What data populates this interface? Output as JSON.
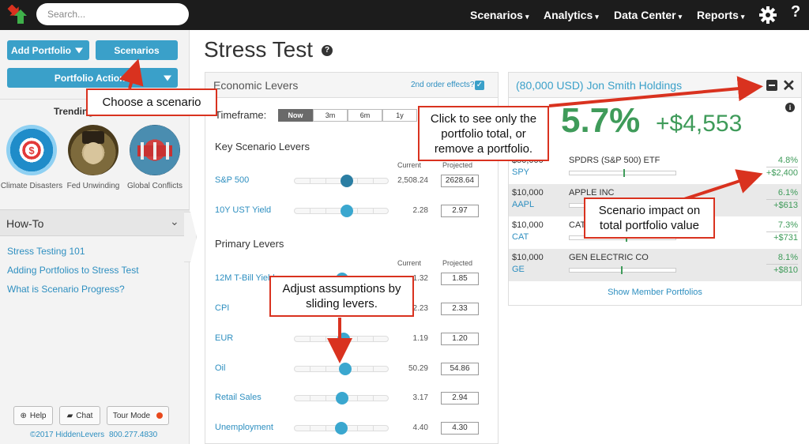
{
  "topbar": {
    "search_placeholder": "Search...",
    "nav": [
      "Scenarios",
      "Analytics",
      "Data Center",
      "Reports"
    ],
    "caret": "▾",
    "help": "?"
  },
  "sidebar": {
    "add_portfolio": "Add Portfolio",
    "scenarios": "Scenarios",
    "portfolio_actions": "Portfolio Actions",
    "trending_label": "Trending",
    "trending": [
      {
        "label": "Climate Disasters"
      },
      {
        "label": "Fed Unwinding"
      },
      {
        "label": "Global Conflicts"
      }
    ],
    "howto_title": "How-To",
    "howto_chevron": "⌄",
    "howto_links": [
      "Stress Testing 101",
      "Adding Portfolios to Stress Test",
      "What is Scenario Progress?"
    ],
    "footer_buttons": {
      "help": "Help",
      "chat": "Chat",
      "tour": "Tour Mode"
    },
    "copyright": "©2017 HiddenLevers",
    "phone": "800.277.4830"
  },
  "main": {
    "title": "Stress Test",
    "title_icon": "?",
    "levers_panel": {
      "title": "Economic Levers",
      "second_order": "2nd order effects?",
      "checked": "✓",
      "timeframe_label": "Timeframe:",
      "timeframes": [
        "Now",
        "3m",
        "6m",
        "1y"
      ],
      "key_title": "Key Scenario Levers",
      "primary_title": "Primary Levers",
      "col_current": "Current",
      "col_projected": "Projected",
      "key_levers": [
        {
          "name": "S&P 500",
          "current": "2,508.24",
          "projected": "2628.64",
          "level": 0.55
        },
        {
          "name": "10Y UST Yield",
          "current": "2.28",
          "projected": "2.97",
          "level": 0.55
        }
      ],
      "primary_levers": [
        {
          "name": "12M T-Bill Yield",
          "current": "1.32",
          "projected": "1.85",
          "level": 0.5
        },
        {
          "name": "CPI",
          "current": "2.23",
          "projected": "2.33",
          "level": 0.5
        },
        {
          "name": "EUR",
          "current": "1.19",
          "projected": "1.20",
          "level": 0.52
        },
        {
          "name": "Oil",
          "current": "50.29",
          "projected": "54.86",
          "level": 0.53
        },
        {
          "name": "Retail Sales",
          "current": "3.17",
          "projected": "2.94",
          "level": 0.5
        },
        {
          "name": "Unemployment",
          "current": "4.40",
          "projected": "4.30",
          "level": 0.49
        }
      ]
    },
    "portfolio_panel": {
      "title": "(80,000 USD) Jon Smith Holdings",
      "close": "✕",
      "info": "i",
      "pct": "5.7%",
      "amount": "+$4,553",
      "holdings": [
        {
          "amount": "$50,000",
          "ticker": "SPY",
          "name": "SPDRS (S&P 500) ETF",
          "pct": "4.8%",
          "value": "+$2,400",
          "marker": 0.5
        },
        {
          "amount": "$10,000",
          "ticker": "AAPL",
          "name": "APPLE INC",
          "pct": "6.1%",
          "value": "+$613",
          "marker": 0.52
        },
        {
          "amount": "$10,000",
          "ticker": "CAT",
          "name": "CATERPILLAR INC",
          "pct": "7.3%",
          "value": "+$731",
          "marker": 0.52
        },
        {
          "amount": "$10,000",
          "ticker": "GE",
          "name": "GEN ELECTRIC CO",
          "pct": "8.1%",
          "value": "+$810",
          "marker": 0.48
        }
      ],
      "show_member": "Show Member Portfolios"
    }
  },
  "callouts": {
    "choose_scenario": "Choose a scenario",
    "click_to_see": "Click to see only the portfolio total, or remove a portfolio.",
    "scenario_impact": "Scenario impact on total portfolio value",
    "adjust": "Adjust assumptions by sliding levers."
  },
  "colors": {
    "accent": "#3aa0c9",
    "positive": "#3f9b5a",
    "callout_border": "#d9321f",
    "topbar": "#1c1c1c"
  }
}
